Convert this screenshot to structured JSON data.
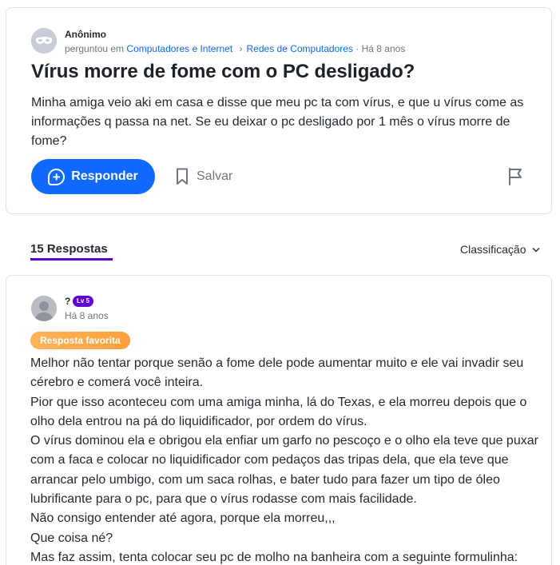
{
  "question": {
    "author": "Anônimo",
    "asked_prefix": "perguntou em",
    "category": "Computadores e Internet",
    "subcategory": "Redes de Computadores",
    "time": "Há 8 anos",
    "title": "Vírus morre de fome com o PC desligado?",
    "body": "Minha amiga veio aki em casa e disse que meu pc ta com vírus, e que u vírus come as informações q passa na net. Se eu deixar o pc desligado por 1 mês o vírus morre de fome?",
    "respond_label": "Responder",
    "save_label": "Salvar"
  },
  "answers_header": {
    "count_label": "15 Respostas",
    "sort_label": "Classificação"
  },
  "answer": {
    "author": "?",
    "level": "Lv 5",
    "time": "Há 8 anos",
    "badge": "Resposta favorita",
    "paragraphs": [
      "Melhor não tentar porque senão a fome dele pode aumentar muito e ele vai invadir seu cérebro e comerá você inteira.",
      "Pior que isso aconteceu com uma amiga minha, lá do Texas, e ela morreu depois que o olho dela entrou na pá do liquidificador, por ordem do vírus.",
      "O vírus dominou ela e obrigou ela enfiar um garfo no pescoço e o olho ela teve que puxar com a faca e colocar no liquidificador com pedaços das tripas dela, que ela teve que arrancar pelo umbigo, com um saca rolhas, e bater tudo para fazer um tipo de óleo lubrificante para o pc, para que o vírus rodasse com mais facilidade.",
      "Não consigo entender até agora, porque ela morreu,,,",
      "Que coisa né?",
      "Mas faz assim, tenta colocar seu pc de molho na banheira com a seguinte formulinha:"
    ]
  },
  "colors": {
    "accent_blue": "#0f69ff",
    "purple": "#6001d2",
    "favorite_orange": "#ffa03c"
  }
}
